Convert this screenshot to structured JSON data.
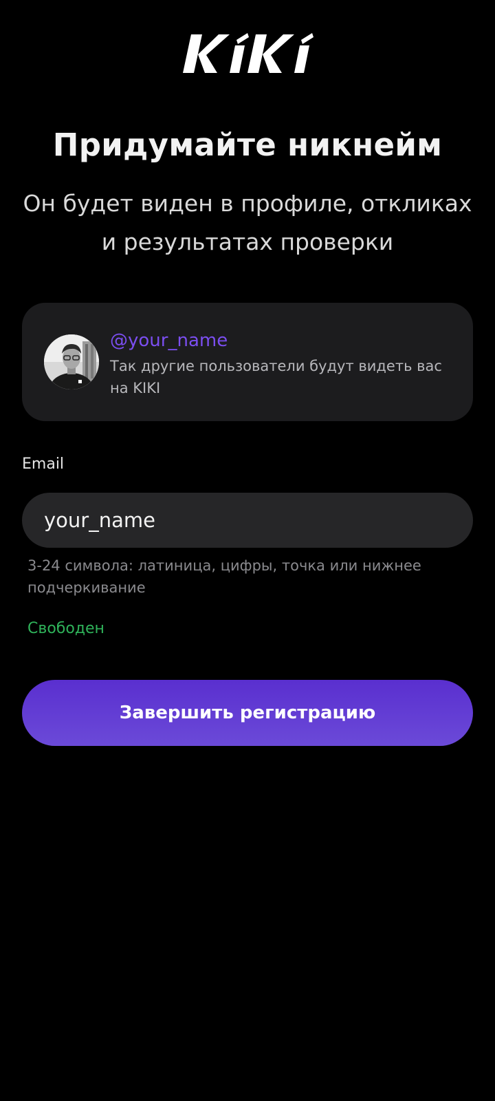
{
  "brand": {
    "logo_text": "KIKI"
  },
  "header": {
    "title": "Придумайте никнейм",
    "subtitle": "Он будет виден в профиле, откликах и результатах проверки"
  },
  "preview": {
    "handle": "@your_name",
    "description": "Так другие пользователи будут видеть вас на KIKI",
    "avatar_icon": "user-photo"
  },
  "form": {
    "field_label": "Email",
    "field_value": "your_name",
    "hint": "3-24 символа: латиница, цифры, точка или нижнее подчеркивание",
    "status": "Свободен"
  },
  "actions": {
    "submit_label": "Завершить регистрацию"
  },
  "colors": {
    "background": "#000000",
    "card": "#1c1c1e",
    "input": "#262628",
    "accent": "#7b4ef0",
    "button": "#5a2fcf",
    "success": "#2fb35a",
    "muted_text": "#8a8a8e"
  }
}
